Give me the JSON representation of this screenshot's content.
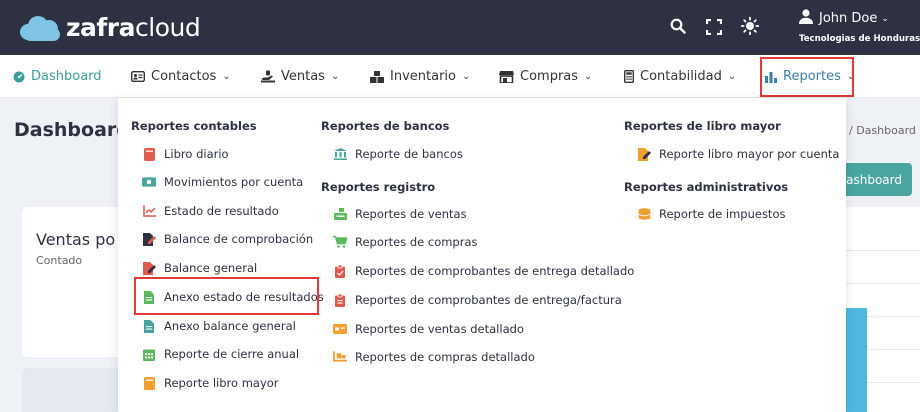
{
  "brand": {
    "name_bold": "zafra",
    "name_light": "cloud"
  },
  "user": {
    "name": "John Doe",
    "company": "Tecnologias de Honduras"
  },
  "nav": [
    {
      "label": "Dashboard",
      "icon": "dashboard-icon"
    },
    {
      "label": "Contactos",
      "icon": "contacts-icon"
    },
    {
      "label": "Ventas",
      "icon": "sales-icon"
    },
    {
      "label": "Inventario",
      "icon": "inventory-icon"
    },
    {
      "label": "Compras",
      "icon": "store-icon"
    },
    {
      "label": "Contabilidad",
      "icon": "calculator-icon"
    },
    {
      "label": "Reportes",
      "icon": "bar-chart-icon"
    }
  ],
  "page": {
    "title": "Dashboard",
    "breadcrumb": "/ Dashboard",
    "button": "dashboard",
    "card_title": "Ventas po",
    "card_sub": "Contado"
  },
  "menu": {
    "contables": {
      "title": "Reportes contables",
      "items": [
        "Libro diario",
        "Movimientos por cuenta",
        "Estado de resultado",
        "Balance de comprobación",
        "Balance general",
        "Anexo estado de resultados",
        "Anexo balance general",
        "Reporte de cierre anual",
        "Reporte libro mayor"
      ]
    },
    "bancos": {
      "title": "Reportes de bancos",
      "items": [
        "Reporte de bancos"
      ]
    },
    "registro": {
      "title": "Reportes registro",
      "items": [
        "Reportes de ventas",
        "Reportes de compras",
        "Reportes de comprobantes de entrega detallado",
        "Reportes de comprobantes de entrega/factura",
        "Reportes de ventas detallado",
        "Reportes de compras detallado"
      ]
    },
    "mayor": {
      "title": "Reportes de libro mayor",
      "items": [
        "Reporte libro mayor por cuenta"
      ]
    },
    "administrativos": {
      "title": "Reportes administrativos",
      "items": [
        "Reporte de impuestos"
      ]
    }
  },
  "colors": {
    "header": "#2d3142",
    "accent": "#3b9e9a",
    "highlight": "#e53935"
  }
}
